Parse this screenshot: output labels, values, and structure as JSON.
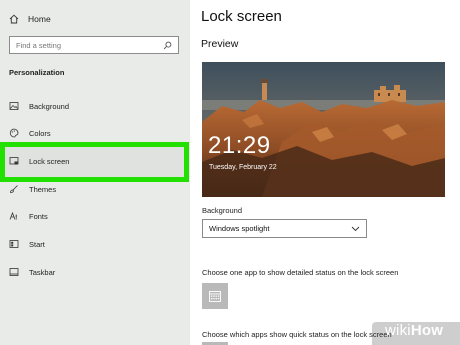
{
  "sidebar": {
    "home_label": "Home",
    "search_placeholder": "Find a setting",
    "section_title": "Personalization",
    "items": [
      {
        "label": "Background",
        "icon": "image-icon"
      },
      {
        "label": "Colors",
        "icon": "palette-icon"
      },
      {
        "label": "Lock screen",
        "icon": "lock-screen-icon",
        "selected": true
      },
      {
        "label": "Themes",
        "icon": "brush-icon"
      },
      {
        "label": "Fonts",
        "icon": "font-icon"
      },
      {
        "label": "Start",
        "icon": "start-icon"
      },
      {
        "label": "Taskbar",
        "icon": "taskbar-icon"
      }
    ]
  },
  "main": {
    "title": "Lock screen",
    "preview_label": "Preview",
    "preview": {
      "time": "21:29",
      "date": "Tuesday, February 22"
    },
    "background_label": "Background",
    "background_value": "Windows spotlight",
    "detailed_status_label": "Choose one app to show detailed status on the lock screen",
    "quick_status_label": "Choose which apps show quick status on the lock screen"
  },
  "watermark": {
    "wiki": "wiki",
    "how": "How"
  },
  "colors": {
    "highlight": "#22e000",
    "sidebar_bg": "#e9ebe9",
    "tile": "#b9b9b9"
  }
}
